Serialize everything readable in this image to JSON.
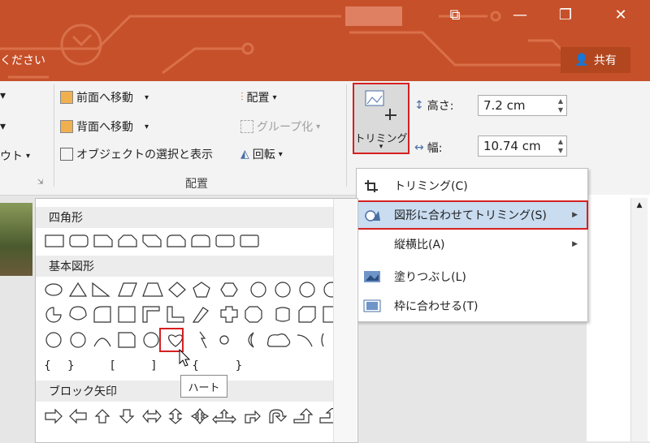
{
  "titlebar": {
    "tell_me_partial": "ください",
    "share_label": "共有",
    "bg_color": "#c6502a"
  },
  "ribbon": {
    "arrange": {
      "bring_forward": "前面へ移動",
      "send_backward": "背面へ移動",
      "selection_pane": "オブジェクトの選択と表示",
      "align": "配置",
      "group": "グループ化",
      "rotate": "回転",
      "group_label": "配置"
    },
    "left_partial": "ウト",
    "size": {
      "trim_label": "トリミング",
      "height_label": "高さ:",
      "height_value": "7.2 cm",
      "width_label": "幅:",
      "width_value": "10.74 cm"
    }
  },
  "trim_menu": {
    "items": [
      {
        "label": "トリミング(C)",
        "icon": "crop-icon"
      },
      {
        "label": "図形に合わせてトリミング(S)",
        "icon": "crop-to-shape-icon",
        "submenu": true
      },
      {
        "label": "縦横比(A)",
        "icon": "",
        "submenu": true
      },
      {
        "label": "塗りつぶし(L)",
        "icon": "fill-icon"
      },
      {
        "label": "枠に合わせる(T)",
        "icon": "fit-icon"
      }
    ]
  },
  "gallery": {
    "sections": [
      "四角形",
      "基本図形",
      "ブロック矢印"
    ],
    "tooltip": "ハート",
    "brackets_row": [
      "{}",
      "[",
      "]",
      "{",
      "}"
    ]
  }
}
